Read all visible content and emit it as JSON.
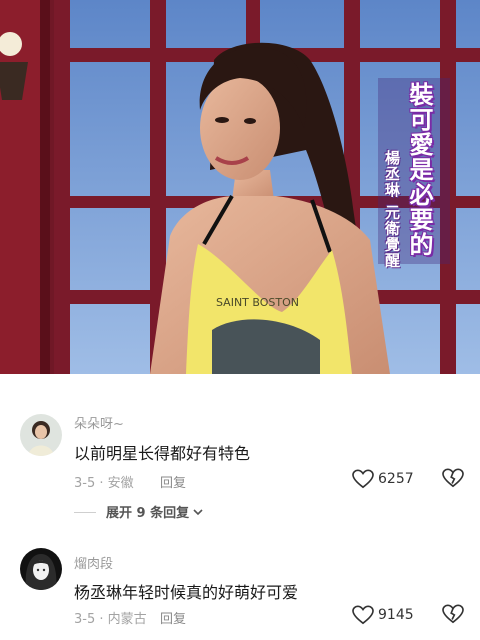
{
  "video": {
    "caption_main": "裝可愛是必要的",
    "caption_sub": "楊丞琳 元衛覺醒",
    "shirt_text": "SAINT BOSTON"
  },
  "comments": [
    {
      "username": "朵朵呀~",
      "content": "以前明星长得都好有特色",
      "date": "3-5",
      "location": "安徽",
      "reply_label": "回复",
      "likes": "6257"
    },
    {
      "username": "熘肉段",
      "content": "杨丞琳年轻时候真的好萌好可爱",
      "date": "3-5",
      "location": "内蒙古",
      "reply_label": "回复",
      "likes": "9145"
    }
  ],
  "expand_replies": "展开 9 条回复",
  "colors": {
    "accent_purple": "#7a2aa6",
    "text_secondary": "#9a9a9a"
  }
}
